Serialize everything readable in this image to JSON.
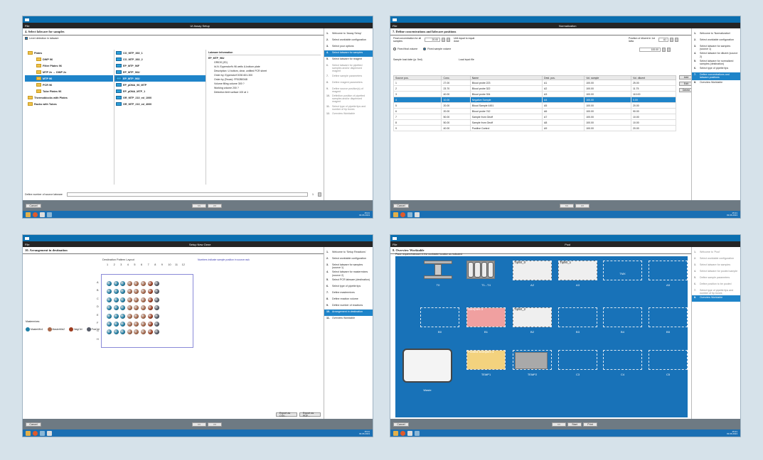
{
  "common": {
    "file_menu": "File",
    "cancel": "Cancel",
    "back": "<<",
    "next": ">>",
    "clock_time": "15:21",
    "clock_date": "03.06.2013"
  },
  "p1": {
    "window_title": "UI Assay Setup",
    "heading": "4. Select labware for samples",
    "level_detection": "Level detection in labware",
    "tree": [
      {
        "label": "Plates",
        "indent": 0
      },
      {
        "label": "DWP 96",
        "indent": 1
      },
      {
        "label": "Filter Plates 96",
        "indent": 1
      },
      {
        "label": "MTP 2x → DWP 2x",
        "indent": 1
      },
      {
        "label": "MTP 96",
        "indent": 1
      },
      {
        "label": "PCR 96",
        "indent": 1
      },
      {
        "label": "Tube Plates 96",
        "indent": 1
      },
      {
        "label": "Thermoblocks with Plates",
        "indent": 0
      },
      {
        "label": "Racks with Tubes",
        "indent": 0
      }
    ],
    "tree_selected": 4,
    "labware": [
      "CO_MTP_360_1",
      "CO_MTP_360_2",
      "EP_MTP_96F",
      "EP_MTP_96U",
      "EP_MTP_96U",
      "EP_pDNA_96_MTP",
      "EP_pDNA_MTP_1",
      "GR_MTP_210_ed_1000",
      "GR_MTP_210_ed_4000"
    ],
    "labware_selected": 4,
    "info_title": "Labware Information",
    "info_name": "EP_MTP_96U",
    "info_lines": [
      "GRIDS (2D)",
      "Id-N. Eppendorf's 96 wells U-bottom plate",
      "Description: U bottom, clear, untilted PCR sheet",
      "Order by: Eppendorf 0030.601.300",
      "Order by (Tecan): FR02B0348",
      "Volume filling volume 300 ?",
      "Working volume 200 ?",
      "Detection limit surface 100 at 1"
    ],
    "define_number": "Define number of source labware",
    "number_value": "1"
  },
  "p1_steps": [
    {
      "n": "1.",
      "t": "Welcome to 'Assay Setup'",
      "s": "norm"
    },
    {
      "n": "2.",
      "t": "Select worktable configuration",
      "s": "norm"
    },
    {
      "n": "3.",
      "t": "Select your options",
      "s": "norm"
    },
    {
      "n": "4.",
      "t": "Select labware for samples",
      "s": "act"
    },
    {
      "n": "5.",
      "t": "Select labware for reagent",
      "s": "norm"
    },
    {
      "n": "6.",
      "t": "Select labware for pipetted samples and/or dispensed reagent",
      "s": "dim"
    },
    {
      "n": "7.",
      "t": "Define sample parameters",
      "s": "dim"
    },
    {
      "n": "8.",
      "t": "Define reagent parameters",
      "s": "dim"
    },
    {
      "n": "9.",
      "t": "Define source position(s) of reagent",
      "s": "dim"
    },
    {
      "n": "10.",
      "t": "Definition position of pipetted samples and/or dispensed reagent",
      "s": "dim"
    },
    {
      "n": "11.",
      "t": "Select type of pipette tips and number of tip boxes",
      "s": "dim"
    },
    {
      "n": "12.",
      "t": "Overview Worktable",
      "s": "dim"
    }
  ],
  "p2": {
    "window_title": "Normalization",
    "heading": "7. Define concentrations and labware positions",
    "final_conc": "Final concentration for all samples",
    "final_conc_val": "20.00",
    "unit_label": "Unit equal to equal dose",
    "position_diluent": "Position of diluent in 1st labw",
    "position_val": "A1",
    "fixed_final": "Fixed final volume",
    "fixed_sample": "Fixed sample volume",
    "sample_vol_val": "100.00",
    "sample_load": "Sample load date (yr. 5ml)",
    "load_input": "Load input file",
    "columns": [
      "Source pos.",
      "Conc.",
      "Name",
      "Dest. pos.",
      "Vol. sample",
      "Vol. diluent"
    ],
    "rows": [
      [
        "1",
        "27.00",
        "Blood probe 223",
        "A1",
        "100.00",
        "25.00"
      ],
      [
        "2",
        "23.70",
        "Blood probe 322",
        "A2",
        "100.00",
        "11.75"
      ],
      [
        "3",
        "40.00",
        "Blood probe 334",
        "A3",
        "100.00",
        "110.00"
      ],
      [
        "4",
        "10.00",
        "Negative Sample",
        "A4",
        "100.00",
        "0.00"
      ],
      [
        "5",
        "20.00",
        "Blood Sample 4451",
        "A5",
        "100.00",
        "20.00"
      ],
      [
        "6",
        "20.00",
        "Blood probe 742",
        "A6",
        "100.00",
        "90.00"
      ],
      [
        "7",
        "50.00",
        "Sample from Geoff",
        "A7",
        "100.00",
        "10.00"
      ],
      [
        "8",
        "50.00",
        "Sample from Geoff",
        "A8",
        "100.00",
        "10.00"
      ],
      [
        "9",
        "40.00",
        "Positive Control",
        "A9",
        "100.00",
        "20.00"
      ]
    ],
    "selected_row": 3,
    "side_buttons": [
      "Add",
      "Edit",
      "Delete"
    ]
  },
  "p2_steps": [
    {
      "n": "1.",
      "t": "Welcome to 'Normalization'",
      "s": "norm"
    },
    {
      "n": "2.",
      "t": "Select worktable configuration",
      "s": "norm"
    },
    {
      "n": "3.",
      "t": "Select labware for samples (source 1)",
      "s": "norm"
    },
    {
      "n": "4.",
      "t": "Select labware for diluent (source 2)",
      "s": "norm"
    },
    {
      "n": "5.",
      "t": "Select labware for normalized samples (destination)",
      "s": "norm"
    },
    {
      "n": "6.",
      "t": "Select type of pipette tips",
      "s": "norm"
    },
    {
      "n": "7.",
      "t": "Define concentrations and labware positions",
      "s": "act"
    },
    {
      "n": "8.",
      "t": "Overview Worktable",
      "s": "norm"
    }
  ],
  "p3": {
    "window_title": "Setup New Gene",
    "heading": "10. Arrangement in destination",
    "pattern_label": "Destination Pattern Layout",
    "numbers_note": "Numbers indicate sample position in source rack",
    "cols": [
      "1",
      "2",
      "3",
      "4",
      "5",
      "6",
      "7",
      "8",
      "9",
      "10",
      "11",
      "12"
    ],
    "rows": [
      "A",
      "B",
      "C",
      "D",
      "E",
      "F",
      "G",
      "H"
    ],
    "mastermixes_label": "Mastermixes:",
    "legend": [
      {
        "name": "MasterMix1",
        "color": "#1e7fa6"
      },
      {
        "name": "MasterMix2",
        "color": "#a8684a"
      },
      {
        "name": "NegCtrl",
        "color": "#9c3b1e"
      },
      {
        "name": "PosCtrl",
        "color": "#555a66"
      }
    ],
    "export_csv": "Export as CSV...",
    "export_pdf": "Export as PDF..."
  },
  "p3_steps": [
    {
      "n": "1.",
      "t": "Welcome to 'Setup Reactions'",
      "s": "norm"
    },
    {
      "n": "2.",
      "t": "Select worktable configuration",
      "s": "norm"
    },
    {
      "n": "3.",
      "t": "Select labware for samples (source 1)",
      "s": "norm"
    },
    {
      "n": "4.",
      "t": "Select labware for mastermixes (source 2)",
      "s": "norm"
    },
    {
      "n": "5.",
      "t": "Select PCR labware (destination)",
      "s": "norm"
    },
    {
      "n": "6.",
      "t": "Select type of pipette tips",
      "s": "norm"
    },
    {
      "n": "7.",
      "t": "Define mastermixes",
      "s": "norm"
    },
    {
      "n": "8.",
      "t": "Define reaction volume",
      "s": "norm"
    },
    {
      "n": "9.",
      "t": "Define number of reactions",
      "s": "norm"
    },
    {
      "n": "10.",
      "t": "Arrangement in destination",
      "s": "act"
    },
    {
      "n": "11.",
      "t": "Overview Worktable",
      "s": "norm"
    }
  ],
  "p4": {
    "window_title": "Pool",
    "heading": "8. Overview Worktable",
    "instruction": "Place required labware in the worktable location as indicated",
    "waste": "Waste",
    "tip1": "Tip50_0",
    "tip2": "Tip50_1",
    "tip3": "Tip50_2",
    "samples": "Samples 1",
    "pooled": "Pooled Samples 1",
    "slots": [
      "T0",
      "T1...T4",
      "A2",
      "A3",
      "TMX",
      "A5",
      "B0",
      "B1",
      "B2",
      "B3",
      "B4",
      "B5",
      "TEMP1",
      "TEMP2",
      "C3",
      "C4",
      "C5"
    ],
    "bottom_buttons": [
      "<<",
      "Start",
      "Print"
    ]
  },
  "p4_steps": [
    {
      "n": "1.",
      "t": "Welcome to 'Pool'",
      "s": "dim"
    },
    {
      "n": "2.",
      "t": "Select worktable configuration",
      "s": "dim"
    },
    {
      "n": "3.",
      "t": "Select labware for samples",
      "s": "dim"
    },
    {
      "n": "4.",
      "t": "Select labware for pooled sample",
      "s": "dim"
    },
    {
      "n": "5.",
      "t": "Define sample parameters",
      "s": "dim"
    },
    {
      "n": "6.",
      "t": "Define position to be pooled",
      "s": "dim"
    },
    {
      "n": "7.",
      "t": "Select type of pipette tips and number of tip boxes",
      "s": "dim"
    },
    {
      "n": "8.",
      "t": "Overview Worktable",
      "s": "act"
    }
  ]
}
